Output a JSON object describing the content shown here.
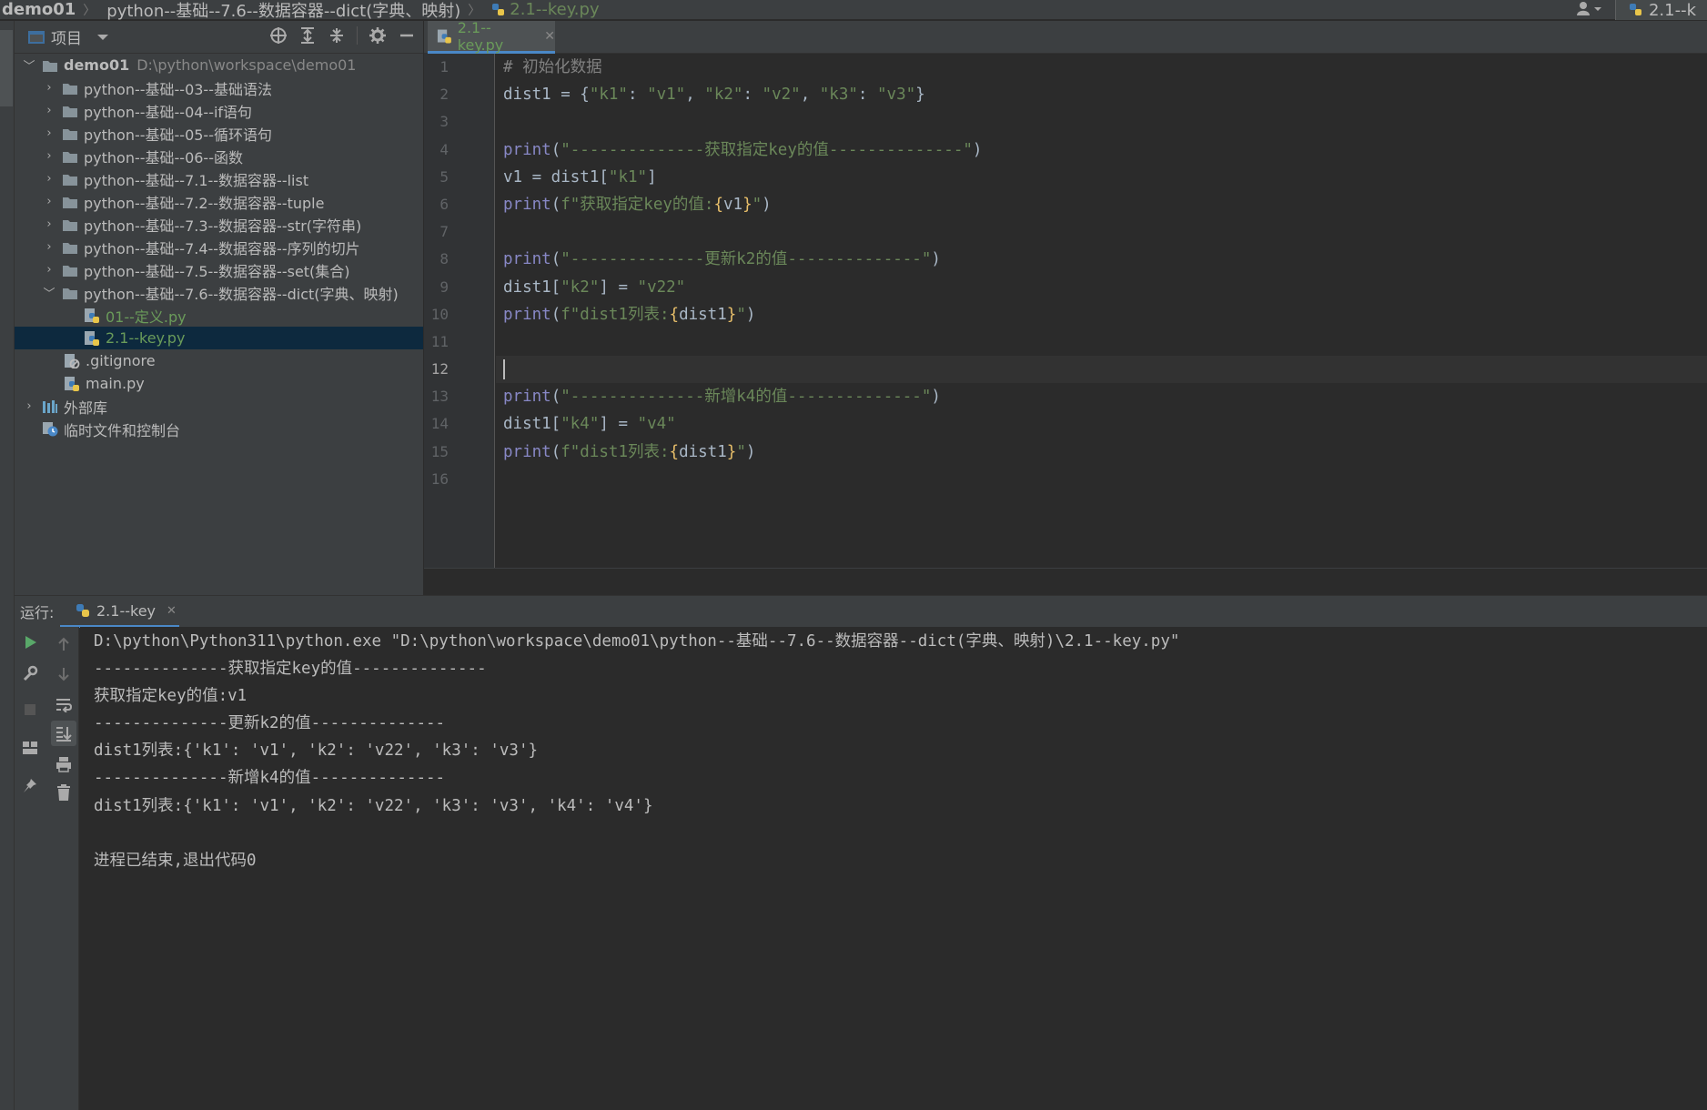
{
  "breadcrumb": {
    "project": "demo01",
    "folder": "python--基础--7.6--数据容器--dict(字典、映射)",
    "file": "2.1--key.py",
    "run_config": "2.1--k"
  },
  "project_panel": {
    "title": "项目",
    "tree": [
      {
        "type": "root",
        "label": "demo01",
        "path": "D:\\python\\workspace\\demo01"
      },
      {
        "type": "folder",
        "label": "python--基础--03--基础语法"
      },
      {
        "type": "folder",
        "label": "python--基础--04--if语句"
      },
      {
        "type": "folder",
        "label": "python--基础--05--循环语句"
      },
      {
        "type": "folder",
        "label": "python--基础--06--函数"
      },
      {
        "type": "folder",
        "label": "python--基础--7.1--数据容器--list"
      },
      {
        "type": "folder",
        "label": "python--基础--7.2--数据容器--tuple"
      },
      {
        "type": "folder",
        "label": "python--基础--7.3--数据容器--str(字符串)"
      },
      {
        "type": "folder",
        "label": "python--基础--7.4--数据容器--序列的切片"
      },
      {
        "type": "folder",
        "label": "python--基础--7.5--数据容器--set(集合)"
      },
      {
        "type": "folder-open",
        "label": "python--基础--7.6--数据容器--dict(字典、映射)"
      },
      {
        "type": "pyfile",
        "label": "01--定义.py"
      },
      {
        "type": "pyfile-selected",
        "label": "2.1--key.py"
      },
      {
        "type": "gitignore",
        "label": ".gitignore"
      },
      {
        "type": "pyfile-plain",
        "label": "main.py"
      },
      {
        "type": "library",
        "label": "外部库"
      },
      {
        "type": "scratch",
        "label": "临时文件和控制台"
      }
    ]
  },
  "editor": {
    "tab_label": "2.1--key.py",
    "line_numbers": [
      "1",
      "2",
      "3",
      "4",
      "5",
      "6",
      "7",
      "8",
      "9",
      "10",
      "11",
      "12",
      "13",
      "14",
      "15",
      "16"
    ],
    "current_line": 12
  },
  "run_panel": {
    "label": "运行:",
    "tab_label": "2.1--key",
    "output": [
      "D:\\python\\Python311\\python.exe \"D:\\python\\workspace\\demo01\\python--基础--7.6--数据容器--dict(字典、映射)\\2.1--key.py\"",
      "--------------获取指定key的值--------------",
      "获取指定key的值:v1",
      "--------------更新k2的值--------------",
      "dist1列表:{'k1': 'v1', 'k2': 'v22', 'k3': 'v3'}",
      "--------------新增k4的值--------------",
      "dist1列表:{'k1': 'v1', 'k2': 'v22', 'k3': 'v3', 'k4': 'v4'}",
      "",
      "进程已结束,退出代码0"
    ]
  },
  "code": {
    "l1_comment": "# 初始化数据",
    "l2_var": "dist1 = {",
    "l2_k1": "\"k1\"",
    "l2_c1": ": ",
    "l2_v1": "\"v1\"",
    "l2_sep1": ", ",
    "l2_k2": "\"k2\"",
    "l2_c2": ": ",
    "l2_v2": "\"v2\"",
    "l2_sep2": ", ",
    "l2_k3": "\"k3\"",
    "l2_c3": ": ",
    "l2_v3": "\"v3\"",
    "l2_end": "}",
    "l4_print": "print",
    "l4_open": "(",
    "l4_str": "\"--------------获取指定key的值--------------\"",
    "l4_close": ")",
    "l5_a": "v1 = dist1[",
    "l5_str": "\"k1\"",
    "l5_b": "]",
    "l6_print": "print",
    "l6_open": "(",
    "l6_str1": "f\"获取指定key的值:",
    "l6_lb": "{",
    "l6_var": "v1",
    "l6_rb": "}",
    "l6_str2": "\"",
    "l6_close": ")",
    "l8_print": "print",
    "l8_open": "(",
    "l8_str": "\"--------------更新k2的值--------------\"",
    "l8_close": ")",
    "l9_a": "dist1[",
    "l9_key": "\"k2\"",
    "l9_b": "] = ",
    "l9_val": "\"v22\"",
    "l10_print": "print",
    "l10_open": "(",
    "l10_str1": "f\"dist1列表:",
    "l10_lb": "{",
    "l10_var": "dist1",
    "l10_rb": "}",
    "l10_str2": "\"",
    "l10_close": ")",
    "l13_print": "print",
    "l13_open": "(",
    "l13_str": "\"--------------新增k4的值--------------\"",
    "l13_close": ")",
    "l14_a": "dist1[",
    "l14_key": "\"k4\"",
    "l14_b": "] = ",
    "l14_val": "\"v4\"",
    "l15_print": "print",
    "l15_open": "(",
    "l15_str1": "f\"dist1列表:",
    "l15_lb": "{",
    "l15_var": "dist1",
    "l15_rb": "}",
    "l15_str2": "\"",
    "l15_close": ")"
  },
  "colors": {
    "comment": "#808080",
    "string": "#6a8759",
    "builtin": "#8888c6",
    "brace": "#e8bf6a",
    "identifier": "#a9b7c6",
    "selection": "#0d293e",
    "accent": "#4a88c7"
  },
  "icons": [
    "folder-icon",
    "python-file-icon",
    "gitignore-icon",
    "library-icon",
    "scratch-icon",
    "target-icon",
    "expand-all-icon",
    "collapse-all-icon",
    "gear-icon",
    "minimize-icon",
    "run-icon",
    "wrench-icon",
    "stop-icon",
    "layout-icon",
    "pin-icon",
    "up-arrow-icon",
    "down-arrow-icon",
    "soft-wrap-icon",
    "scroll-to-end-icon",
    "print-icon",
    "trash-icon",
    "user-icon"
  ]
}
